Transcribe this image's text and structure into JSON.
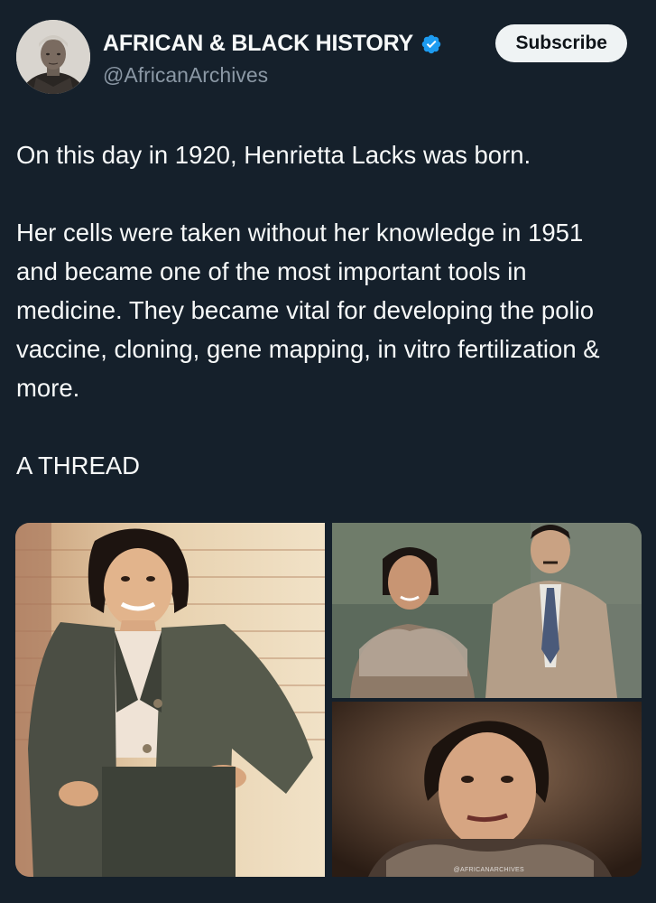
{
  "post": {
    "author": {
      "display_name": "AFRICAN & BLACK HISTORY",
      "handle": "@AfricanArchives",
      "verified_icon": "verified-badge-icon"
    },
    "subscribe_label": "Subscribe",
    "paragraphs": [
      "On this day in 1920, Henrietta Lacks was born.",
      "Her cells were taken without her knowledge in 1951 and became one of the most important tools in medicine. They became vital for developing the polio vaccine, cloning, gene mapping, in vitro fertilization & more.",
      "A THREAD"
    ],
    "media": {
      "watermark": "@AFRICANARCHIVES"
    }
  },
  "colors": {
    "background": "#15202b",
    "text": "#f7f9f9",
    "secondary_text": "#8b98a5",
    "verified": "#1d9bf0",
    "button_bg": "#eff3f4",
    "button_text": "#0f1419"
  }
}
